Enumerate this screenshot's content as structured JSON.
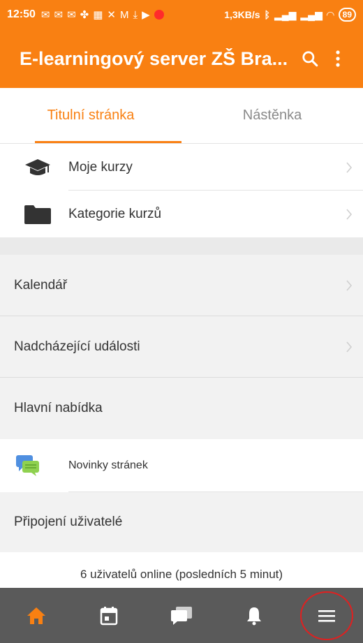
{
  "status_bar": {
    "time": "12:50",
    "network_speed": "1,3KB/s",
    "battery": "89"
  },
  "app_bar": {
    "title": "E-learningový server ZŠ Bra..."
  },
  "tabs": [
    {
      "label": "Titulní stránka",
      "active": true
    },
    {
      "label": "Nástěnka",
      "active": false
    }
  ],
  "course_list": [
    {
      "label": "Moje kurzy",
      "icon": "graduation-cap-icon"
    },
    {
      "label": "Kategorie kurzů",
      "icon": "folder-icon"
    }
  ],
  "blocks": [
    {
      "label": "Kalendář",
      "chevron": true
    },
    {
      "label": "Nadcházející události",
      "chevron": true
    },
    {
      "label": "Hlavní nabídka",
      "chevron": false
    }
  ],
  "news": {
    "label": "Novinky stránek",
    "icon": "chat-bubbles-icon"
  },
  "online_users": {
    "label": "Připojení uživatelé",
    "footer": "6 uživatelů online (posledních 5 minut)"
  },
  "bottom_nav": [
    {
      "name": "home",
      "icon": "home-icon",
      "active": true
    },
    {
      "name": "calendar",
      "icon": "calendar-icon",
      "active": false
    },
    {
      "name": "messages",
      "icon": "messages-icon",
      "active": false
    },
    {
      "name": "notifications",
      "icon": "bell-icon",
      "active": false
    },
    {
      "name": "menu",
      "icon": "hamburger-icon",
      "active": false
    }
  ],
  "colors": {
    "accent": "#f98012",
    "bottom_nav_bg": "#5a5a5a",
    "highlight_circle": "#e02020"
  }
}
